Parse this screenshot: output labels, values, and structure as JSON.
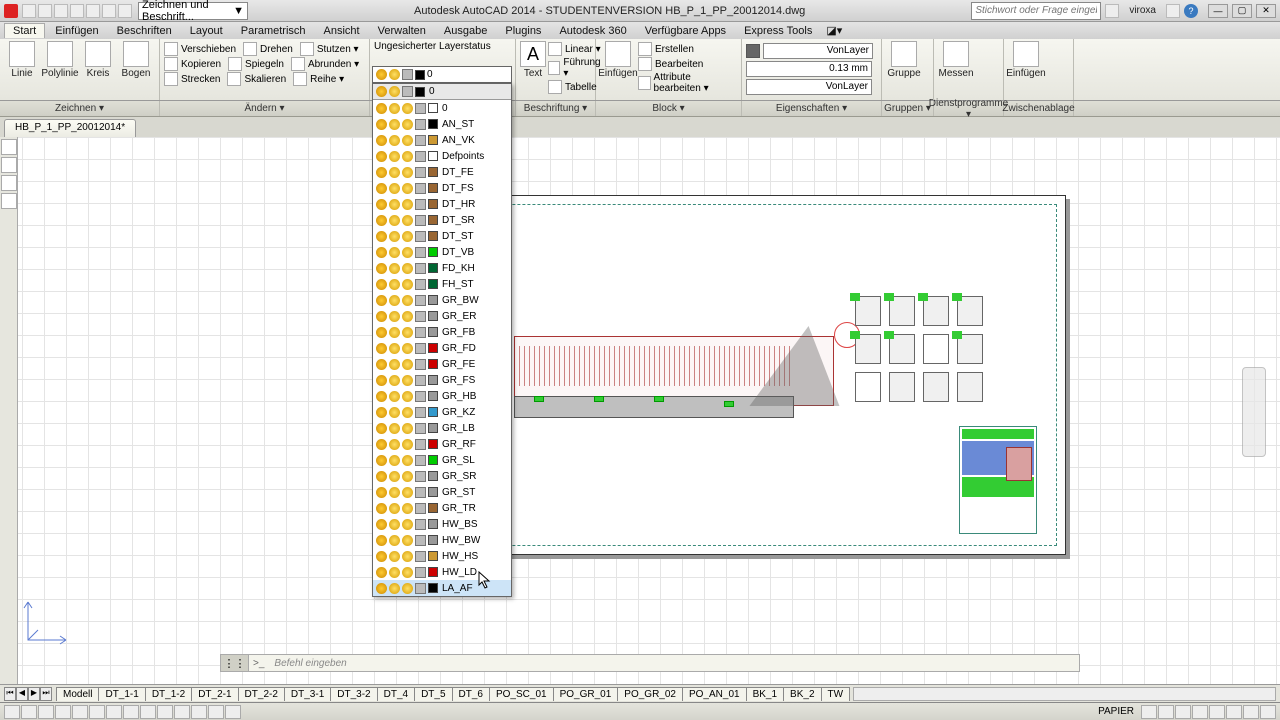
{
  "title": "Autodesk AutoCAD 2014 - STUDENTENVERSION    HB_P_1_PP_20012014.dwg",
  "workspace": "Zeichnen und Beschrift...",
  "search_placeholder": "Stichwort oder Frage eingeben",
  "user": "viroxa",
  "menu": [
    "Start",
    "Einfügen",
    "Beschriften",
    "Layout",
    "Parametrisch",
    "Ansicht",
    "Verwalten",
    "Ausgabe",
    "Plugins",
    "Autodesk 360",
    "Verfügbare Apps",
    "Express Tools"
  ],
  "panels": {
    "zeichnen": "Zeichnen ▾",
    "aendern": "Ändern ▾",
    "beschrift": "Beschriftung ▾",
    "block": "Block ▾",
    "eigen": "Eigenschaften ▾",
    "gruppen": "Gruppen ▾",
    "dienst": "Dienstprogramme ▾",
    "zwisch": "Zwischenablage"
  },
  "draw": {
    "linie": "Linie",
    "polylinie": "Polylinie",
    "kreis": "Kreis",
    "bogen": "Bogen"
  },
  "modify": {
    "verschieben": "Verschieben",
    "drehen": "Drehen",
    "stutzen": "Stutzen ▾",
    "kopieren": "Kopieren",
    "spiegeln": "Spiegeln",
    "abrunden": "Abrunden ▾",
    "strecken": "Strecken",
    "skalieren": "Skalieren",
    "reihe": "Reihe ▾"
  },
  "layer": {
    "status": "Ungesicherter Layerstatus",
    "current": "0"
  },
  "anno": {
    "text": "Text",
    "fuehrung": "Führung ▾",
    "tabelle": "Tabelle",
    "linear": "Linear ▾"
  },
  "blockp": {
    "einfuegen": "Einfügen",
    "erstellen": "Erstellen",
    "bearbeiten": "Bearbeiten",
    "attrib": "Attribute bearbeiten ▾"
  },
  "props": {
    "vonlayer": "VonLayer",
    "lw": "0.13 mm",
    "lt": "VonLayer"
  },
  "groups": {
    "gruppe": "Gruppe"
  },
  "util": {
    "messen": "Messen"
  },
  "clip": {
    "einfuegen": "Einfügen"
  },
  "doc_tab": "HB_P_1_PP_20012014*",
  "layers": [
    {
      "n": "0",
      "c": "#ffffff"
    },
    {
      "n": "AN_ST",
      "c": "#000000"
    },
    {
      "n": "AN_VK",
      "c": "#cc9933"
    },
    {
      "n": "Defpoints",
      "c": "#ffffff"
    },
    {
      "n": "DT_FE",
      "c": "#996633"
    },
    {
      "n": "DT_FS",
      "c": "#996633"
    },
    {
      "n": "DT_HR",
      "c": "#996633"
    },
    {
      "n": "DT_SR",
      "c": "#996633"
    },
    {
      "n": "DT_ST",
      "c": "#996633"
    },
    {
      "n": "DT_VB",
      "c": "#00cc00"
    },
    {
      "n": "FD_KH",
      "c": "#006633"
    },
    {
      "n": "FH_ST",
      "c": "#006633"
    },
    {
      "n": "GR_BW",
      "c": "#999999"
    },
    {
      "n": "GR_ER",
      "c": "#999999"
    },
    {
      "n": "GR_FB",
      "c": "#999999"
    },
    {
      "n": "GR_FD",
      "c": "#cc0000"
    },
    {
      "n": "GR_FE",
      "c": "#cc0000"
    },
    {
      "n": "GR_FS",
      "c": "#999999"
    },
    {
      "n": "GR_HB",
      "c": "#999999"
    },
    {
      "n": "GR_KZ",
      "c": "#3399cc"
    },
    {
      "n": "GR_LB",
      "c": "#999999"
    },
    {
      "n": "GR_RF",
      "c": "#cc0000"
    },
    {
      "n": "GR_SL",
      "c": "#00cc00"
    },
    {
      "n": "GR_SR",
      "c": "#999999"
    },
    {
      "n": "GR_ST",
      "c": "#999999"
    },
    {
      "n": "GR_TR",
      "c": "#996633"
    },
    {
      "n": "HW_BS",
      "c": "#999999"
    },
    {
      "n": "HW_BW",
      "c": "#999999"
    },
    {
      "n": "HW_HS",
      "c": "#cc9933"
    },
    {
      "n": "HW_LD",
      "c": "#cc0000"
    },
    {
      "n": "LA_AF",
      "c": "#000000"
    }
  ],
  "cmd_prompt": "Befehl eingeben",
  "layout_tabs": [
    "Modell",
    "DT_1-1",
    "DT_1-2",
    "DT_2-1",
    "DT_2-2",
    "DT_3-1",
    "DT_3-2",
    "DT_4",
    "DT_5",
    "DT_6",
    "PO_SC_01",
    "PO_GR_01",
    "PO_GR_02",
    "PO_AN_01",
    "BK_1",
    "BK_2",
    "TW"
  ],
  "status_label": "PAPIER"
}
